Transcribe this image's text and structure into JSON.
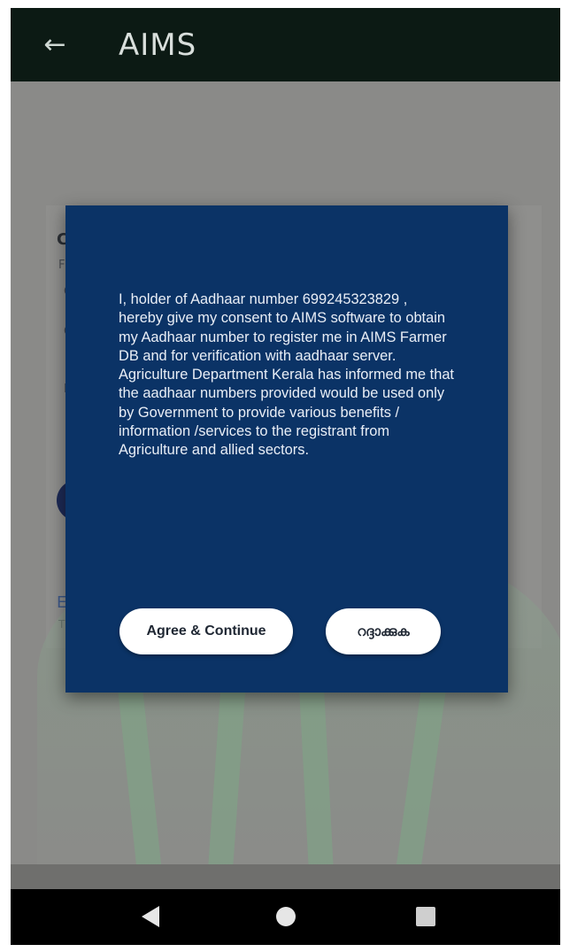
{
  "appbar": {
    "back_icon": "back-arrow-icon",
    "title": "AIMS"
  },
  "background": {
    "letters": [
      "C",
      "F",
      "C",
      "C",
      "E",
      "E",
      "T"
    ]
  },
  "dialog": {
    "message": "I, holder of Aadhaar number 699245323829 , hereby give my consent to AIMS software to obtain my Aadhaar number to register me in AIMS Farmer DB and for verification with aadhaar server. Agriculture Department Kerala has informed me that the aadhaar numbers provided would be used only by Government to provide various benefits / information /services to the registrant from Agriculture and allied sectors.",
    "agree_label": "Agree & Continue",
    "cancel_label": "റദ്ദാക്കുക"
  },
  "navbar": {
    "back_icon": "nav-back-icon",
    "home_icon": "nav-home-icon",
    "recent_icon": "nav-recents-icon"
  },
  "colors": {
    "appbar": "#0c1a14",
    "dialog": "#0b3366",
    "button": "#ffffff"
  }
}
